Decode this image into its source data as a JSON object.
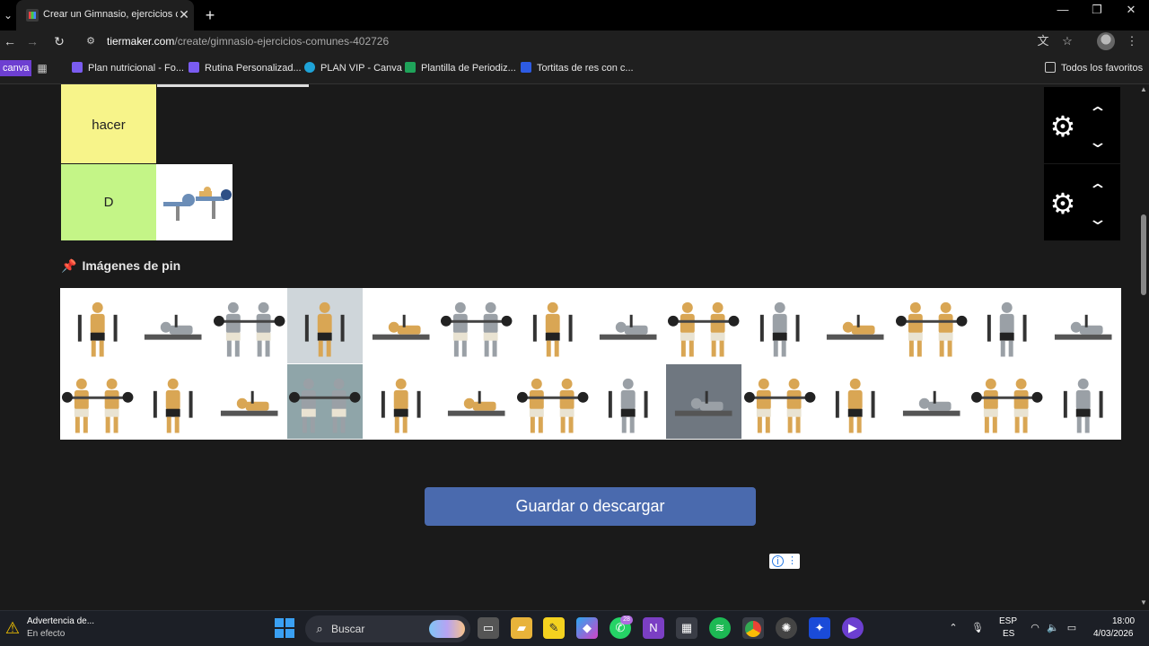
{
  "browser": {
    "tab_title": "Crear un Gimnasio, ejercicios comunes",
    "tab_close": "✕",
    "new_tab": "+",
    "tab_list": "⌄",
    "window_controls": {
      "minimize": "—",
      "maximize": "❐",
      "close": "✕"
    },
    "nav": {
      "back": "←",
      "forward": "→",
      "reload": "↻"
    },
    "url_host": "tiermaker.com",
    "url_path": "/create/gimnasio-ejercicios-comunes-402726",
    "toolbar_icons": {
      "translate": "文",
      "star": "☆",
      "menu": "⋮",
      "site_info": "⚙"
    },
    "bookmarks": [
      {
        "label": "Plan nutricional - Fo...",
        "icon_color": "#7a5cf0"
      },
      {
        "label": "Rutina Personalizad...",
        "icon_color": "#7a5cf0"
      },
      {
        "label": "PLAN VIP - Canva",
        "icon_color": "#1fa3d8"
      },
      {
        "label": "Plantilla de Periodiz...",
        "icon_color": "#1fa35a"
      },
      {
        "label": "Tortitas de res con c...",
        "icon_color": "#2d5be3"
      }
    ],
    "canva_tag": "canva",
    "all_bookmarks": "Todos los favoritos"
  },
  "tiers": [
    {
      "label": "hacer",
      "color": "#f7f48a",
      "items": []
    },
    {
      "label": "D",
      "color": "#c4f587",
      "items": [
        "leg-press-machine"
      ]
    }
  ],
  "tier_controls": {
    "gear": "⚙",
    "up": "⌃",
    "down": "⌄"
  },
  "pin_section": {
    "title": "Imágenes de pin",
    "icon": "📌"
  },
  "pool_count": 28,
  "save_button": "Guardar o descargar",
  "ad_badge": {
    "info": "i",
    "more": "⋮"
  },
  "taskbar": {
    "weather_title": "Advertencia de...",
    "weather_sub": "En efecto",
    "search_placeholder": "Buscar",
    "whatsapp_badge": "28",
    "lang_top": "ESP",
    "lang_bot": "ES",
    "time": "18:00",
    "date": "4/03/2026"
  },
  "colors": {
    "accent_button": "#4a6aae",
    "page_bg": "#1a1a1a"
  }
}
